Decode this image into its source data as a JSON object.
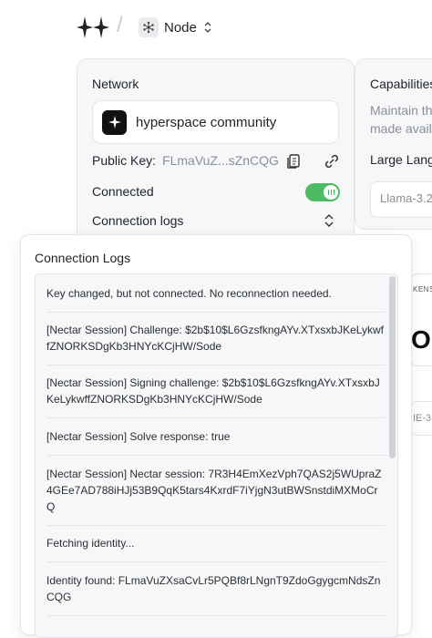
{
  "header": {
    "logo_icon": "sparkles-logo-icon",
    "separator": "/",
    "node_label": "Node",
    "node_icon": "node-network-icon",
    "node_chevron": "⌃⌄"
  },
  "network": {
    "title": "Network",
    "community_name": "hyperspace community",
    "community_icon": "star-icon",
    "public_key_label": "Public Key:",
    "public_key_value": "FLmaVuZ...sZnCQG",
    "copy_icon": "copy-icon",
    "link_icon": "link-icon",
    "connected_label": "Connected",
    "connected_toggle_on": true,
    "connection_logs_label": "Connection logs"
  },
  "capabilities": {
    "title": "Capabilities",
    "description_line1": "Maintain th",
    "description_line2": "made avail",
    "subsection": "Large Lang",
    "select_value": "Llama-3.2"
  },
  "background_cards": {
    "card1_text_small": "KENS",
    "card1_text_big": "OM",
    "card2_text": "IE-3"
  },
  "logs": {
    "title": "Connection Logs",
    "entries": [
      "Key changed, but not connected. No reconnection needed.",
      "[Nectar Session] Challenge: $2b$10$L6GzsfkngAYv.XTxsxbJKeLykwffZNORKSDgKb3HNYcKCjHW/Sode",
      "[Nectar Session] Signing challenge: $2b$10$L6GzsfkngAYv.XTxsxbJKeLykwffZNORKSDgKb3HNYcKCjHW/Sode",
      "[Nectar Session] Solve response: true",
      "[Nectar Session] Nectar session: 7R3H4EmXezVph7QAS2j5WUpraZ4GEe7AD788iHJj53B9QqK5tars4KxrdF7iYjgN3utBWSnstdiMXMoCrQ",
      "Fetching identity...",
      "Identity found: FLmaVuZXsaCvLr5PQBf8rLNgnT9ZdoGgygcmNdsZnCQG"
    ]
  },
  "colors": {
    "toggle_on": "#4cbb63",
    "panel_bg": "#f6f7f8",
    "muted_text": "#8a8f96"
  }
}
